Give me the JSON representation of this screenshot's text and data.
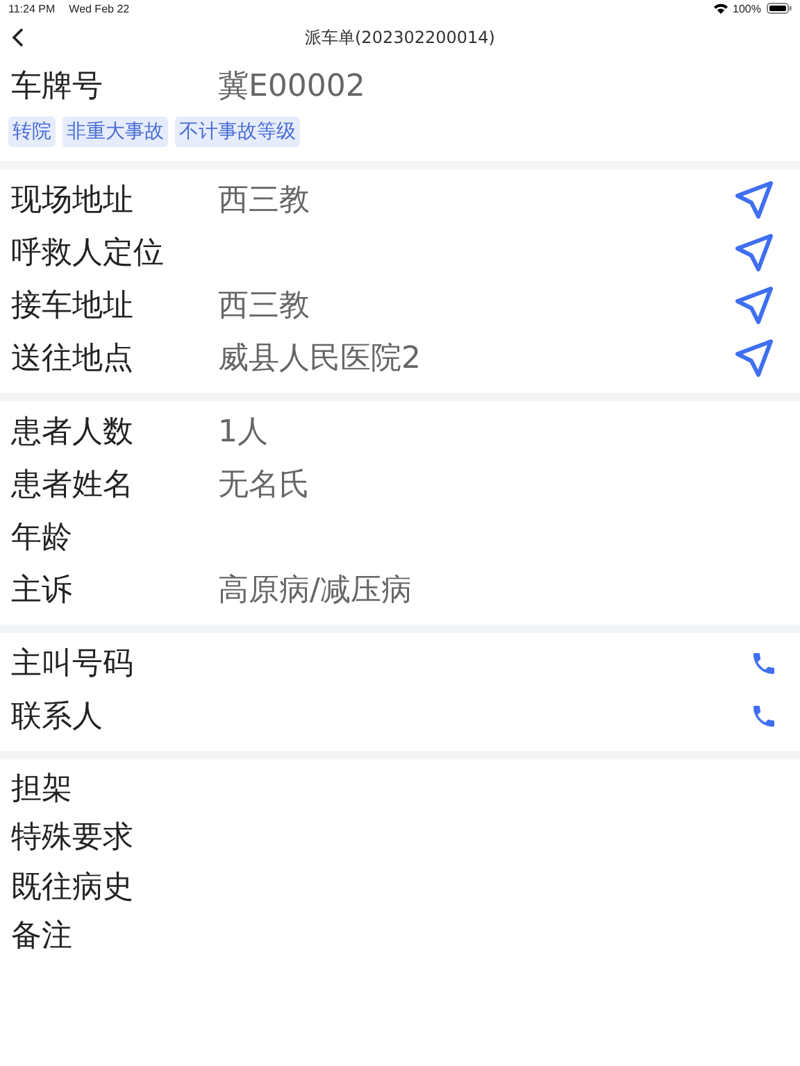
{
  "status_bar": {
    "time": "11:24 PM",
    "date": "Wed Feb 22",
    "battery": "100%"
  },
  "nav": {
    "title": "派车单(202302200014)"
  },
  "plate": {
    "label": "车牌号",
    "value": "冀E00002"
  },
  "tags": [
    "转院",
    "非重大事故",
    "不计事故等级"
  ],
  "sections": [
    {
      "rows": [
        {
          "label": "现场地址",
          "value": "西三教",
          "kind": "navigate"
        },
        {
          "label": "呼救人定位",
          "kind": "navigate"
        },
        {
          "label": "接车地址",
          "value": "西三教",
          "kind": "navigate"
        },
        {
          "label": "送往地点",
          "value": "威县人民医院2",
          "kind": "navigate"
        }
      ]
    },
    {
      "rows": [
        {
          "label": "患者人数",
          "value": "1人"
        },
        {
          "label": "患者姓名",
          "value": "无名氏"
        },
        {
          "label": "年龄"
        },
        {
          "label": "主诉",
          "value": "高原病/减压病"
        }
      ]
    },
    {
      "rows": [
        {
          "label": "主叫号码",
          "kind": "call"
        },
        {
          "label": "联系人",
          "kind": "call"
        }
      ]
    },
    {
      "rows": [
        {
          "label": "担架"
        },
        {
          "label": "特殊要求"
        },
        {
          "label": "既往病史"
        },
        {
          "label": "备注"
        }
      ]
    }
  ]
}
